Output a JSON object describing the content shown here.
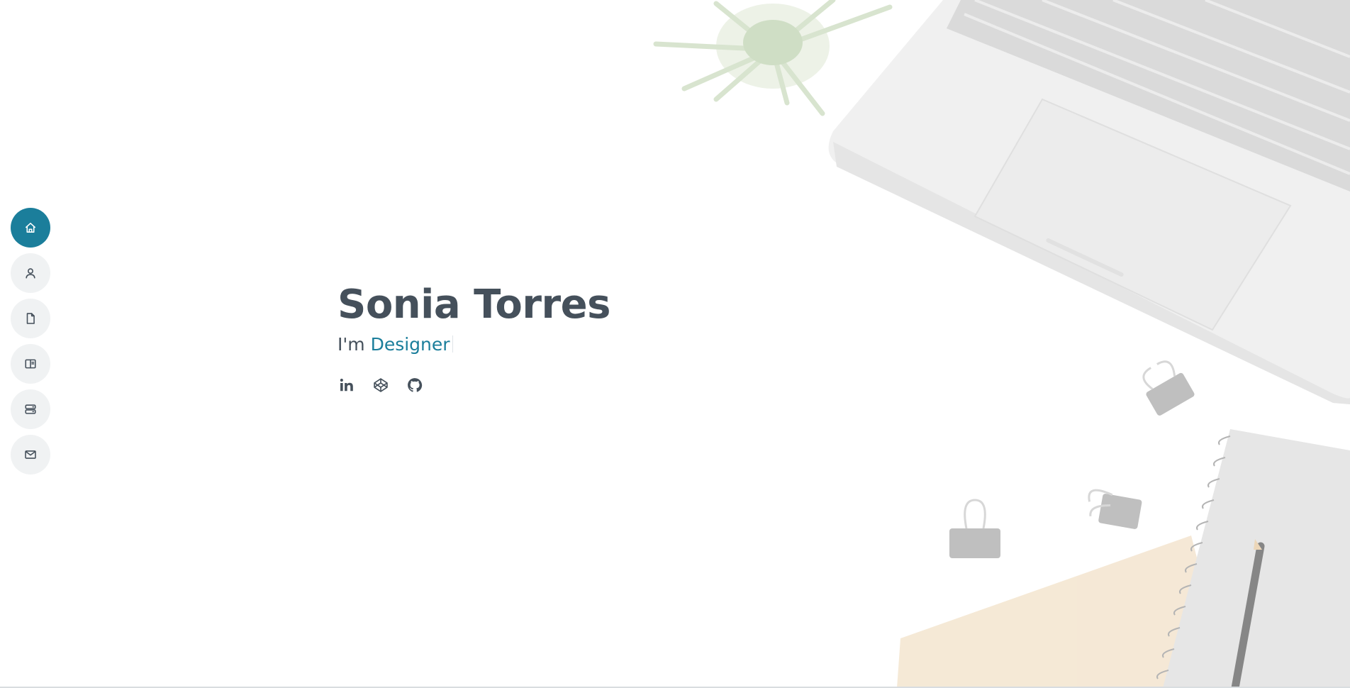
{
  "nav": {
    "items": [
      {
        "icon": "home-icon",
        "active": true
      },
      {
        "icon": "person-icon",
        "active": false
      },
      {
        "icon": "file-icon",
        "active": false
      },
      {
        "icon": "book-half-icon",
        "active": false
      },
      {
        "icon": "server-icon",
        "active": false
      },
      {
        "icon": "envelope-icon",
        "active": false
      }
    ]
  },
  "hero": {
    "name": "Sonia Torres",
    "prefix": "I'm",
    "role": "Designer"
  },
  "social": [
    {
      "icon": "linkedin-icon"
    },
    {
      "icon": "codepen-icon"
    },
    {
      "icon": "github-icon"
    }
  ],
  "colors": {
    "accent": "#1b7e9b",
    "text": "#45505b",
    "nav_bg": "#f0f2f3"
  }
}
